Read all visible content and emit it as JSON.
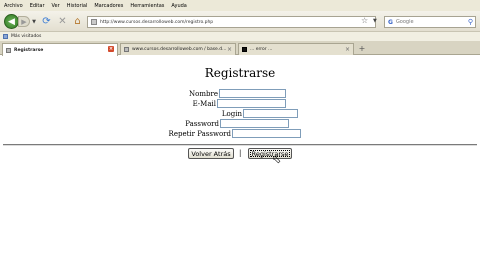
{
  "menu": [
    "Archivo",
    "Editar",
    "Ver",
    "Historial",
    "Marcadores",
    "Herramientas",
    "Ayuda"
  ],
  "toolbar": {
    "url": "http://www.cursos.desarrolloweb.com/registro.php",
    "search_placeholder": "Google"
  },
  "bookmarks": {
    "item": "Más visitados"
  },
  "tabs": [
    {
      "label": "Registrarse",
      "active": true
    },
    {
      "label": "www.cursos.desarrolloweb.com / base.d...",
      "active": false
    },
    {
      "label": "... error ...",
      "active": false
    }
  ],
  "page": {
    "title": "Registrarse",
    "fields": [
      {
        "label": "Nombre"
      },
      {
        "label": "E-Mail"
      },
      {
        "label": "Login"
      },
      {
        "label": "Password"
      },
      {
        "label": "Repetir Password"
      }
    ],
    "back_button": "Volver Atrás",
    "separator": "|",
    "register_button": "Registrarse"
  }
}
